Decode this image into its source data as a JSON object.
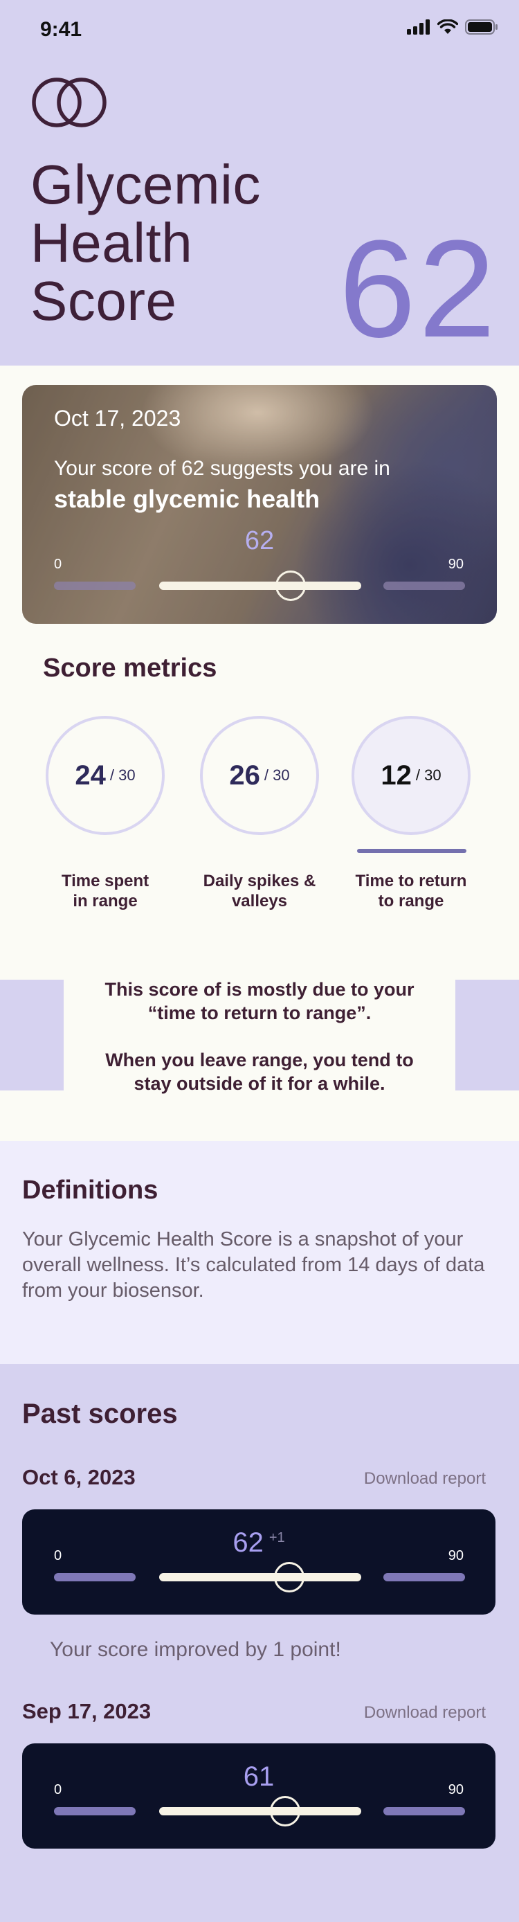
{
  "status_bar": {
    "time": "9:41"
  },
  "header": {
    "title_lines": [
      "Glycemic",
      "Health",
      "Score"
    ],
    "score": "62"
  },
  "hero": {
    "date": "Oct 17, 2023",
    "line1": "Your score of 62 suggests you are in",
    "line2": "stable glycemic health",
    "value": "62",
    "range_min": "0",
    "range_max": "90",
    "level_fraction": 0.689
  },
  "metrics": {
    "title": "Score metrics",
    "items": [
      {
        "value": "24",
        "denominator": "/ 30",
        "label_1": "Time spent",
        "label_2": "in range"
      },
      {
        "value": "26",
        "denominator": "/ 30",
        "label_1": "Daily spikes &",
        "label_2": "valleys"
      },
      {
        "value": "12",
        "denominator": "/ 30",
        "label_1": "Time to return",
        "label_2": "to range"
      }
    ]
  },
  "explanation": {
    "p1_line1": "This score of is mostly due to your",
    "p1_line2": "“time to return to range”.",
    "p2_line1": "When you leave range, you tend to",
    "p2_line2": "stay outside of it for a while."
  },
  "definitions": {
    "title": "Definitions",
    "body": "Your Glycemic Health Score is a snapshot of your overall wellness. It’s calculated from 14 days of data from your biosensor."
  },
  "past_scores": {
    "title": "Past scores",
    "entries": [
      {
        "date": "Oct 6, 2023",
        "download_label": "Download report",
        "value": "62",
        "delta": "+1",
        "range_min": "0",
        "range_max": "90",
        "note": "Your score improved by 1 point!"
      },
      {
        "date": "Sep 17, 2023",
        "download_label": "Download report",
        "value": "61",
        "range_min": "0",
        "range_max": "90"
      }
    ]
  },
  "colors": {
    "header_bg": "#d6d2f0",
    "accent": "#8479cc",
    "text_dark": "#3e1f33",
    "card_dark": "#0c1128"
  }
}
